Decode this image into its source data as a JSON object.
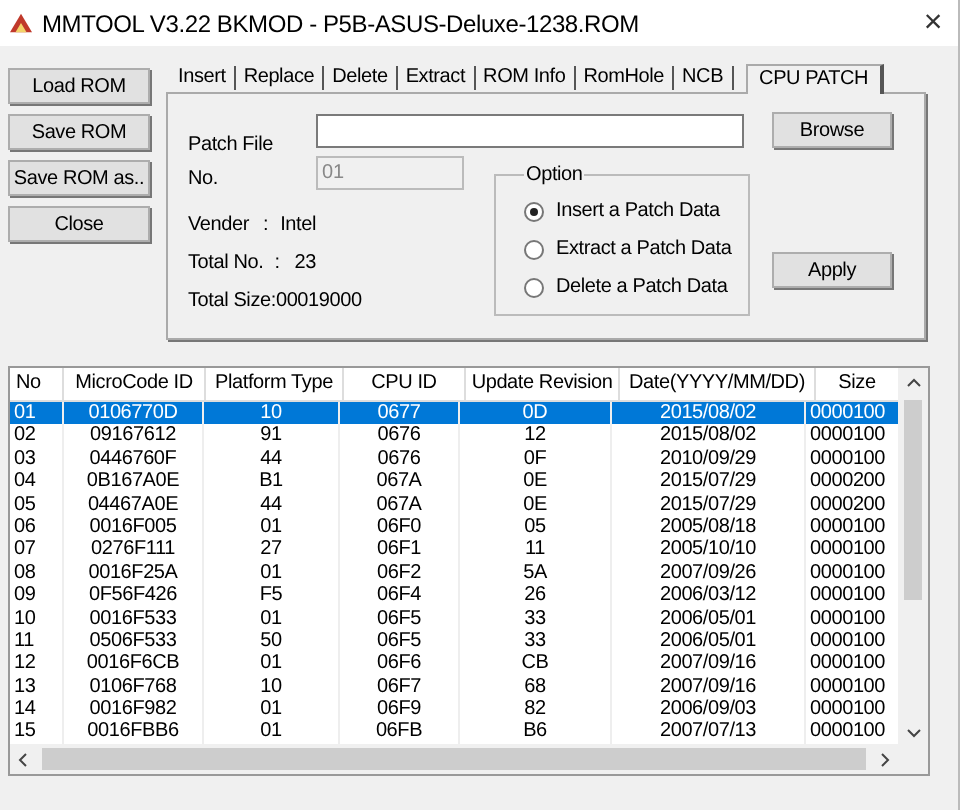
{
  "window": {
    "title": "MMTOOL V3.22 BKMOD - P5B-ASUS-Deluxe-1238.ROM",
    "close": "×"
  },
  "side_buttons": [
    "Load ROM",
    "Save ROM",
    "Save ROM as..",
    "Close"
  ],
  "tabs": [
    {
      "label": "Insert",
      "selected": false
    },
    {
      "label": "Replace",
      "selected": false
    },
    {
      "label": "Delete",
      "selected": false
    },
    {
      "label": "Extract",
      "selected": false
    },
    {
      "label": "ROM Info",
      "selected": false
    },
    {
      "label": "RomHole",
      "selected": false
    },
    {
      "label": "NCB",
      "selected": false
    },
    {
      "label": "CPU PATCH",
      "selected": true
    }
  ],
  "patch": {
    "file_label": "Patch File",
    "no_label": "No.",
    "no_value": "01",
    "browse": "Browse",
    "apply": "Apply",
    "info": [
      {
        "label": "Vender",
        "sep": ":",
        "value": "Intel"
      },
      {
        "label": "Total No.",
        "sep": ":",
        "value": "23"
      },
      {
        "label": "Total Size",
        "sep": ":",
        "value": "00019000"
      }
    ],
    "option": {
      "title": "Option",
      "choices": [
        {
          "label": "Insert a Patch Data",
          "selected": true
        },
        {
          "label": "Extract a Patch Data",
          "selected": false
        },
        {
          "label": "Delete a Patch Data",
          "selected": false
        }
      ]
    }
  },
  "table": {
    "columns": [
      "No",
      "MicroCode ID",
      "Platform Type",
      "CPU ID",
      "Update Revision",
      "Date(YYYY/MM/DD)",
      "Size"
    ],
    "rows": [
      {
        "cells": [
          "01",
          "0106770D",
          "10",
          "0677",
          "0D",
          "2015/08/02",
          "0000100"
        ],
        "selected": true
      },
      {
        "cells": [
          "02",
          "09167612",
          "91",
          "0676",
          "12",
          "2015/08/02",
          "0000100"
        ],
        "selected": false
      },
      {
        "cells": [
          "03",
          "0446760F",
          "44",
          "0676",
          "0F",
          "2010/09/29",
          "0000100"
        ],
        "selected": false
      },
      {
        "cells": [
          "04",
          "0B167A0E",
          "B1",
          "067A",
          "0E",
          "2015/07/29",
          "0000200"
        ],
        "selected": false
      },
      {
        "cells": [
          "05",
          "04467A0E",
          "44",
          "067A",
          "0E",
          "2015/07/29",
          "0000200"
        ],
        "selected": false
      },
      {
        "cells": [
          "06",
          "0016F005",
          "01",
          "06F0",
          "05",
          "2005/08/18",
          "0000100"
        ],
        "selected": false
      },
      {
        "cells": [
          "07",
          "0276F111",
          "27",
          "06F1",
          "11",
          "2005/10/10",
          "0000100"
        ],
        "selected": false
      },
      {
        "cells": [
          "08",
          "0016F25A",
          "01",
          "06F2",
          "5A",
          "2007/09/26",
          "0000100"
        ],
        "selected": false
      },
      {
        "cells": [
          "09",
          "0F56F426",
          "F5",
          "06F4",
          "26",
          "2006/03/12",
          "0000100"
        ],
        "selected": false
      },
      {
        "cells": [
          "10",
          "0016F533",
          "01",
          "06F5",
          "33",
          "2006/05/01",
          "0000100"
        ],
        "selected": false
      },
      {
        "cells": [
          "11",
          "0506F533",
          "50",
          "06F5",
          "33",
          "2006/05/01",
          "0000100"
        ],
        "selected": false
      },
      {
        "cells": [
          "12",
          "0016F6CB",
          "01",
          "06F6",
          "CB",
          "2007/09/16",
          "0000100"
        ],
        "selected": false
      },
      {
        "cells": [
          "13",
          "0106F768",
          "10",
          "06F7",
          "68",
          "2007/09/16",
          "0000100"
        ],
        "selected": false
      },
      {
        "cells": [
          "14",
          "0016F982",
          "01",
          "06F9",
          "82",
          "2006/09/03",
          "0000100"
        ],
        "selected": false
      },
      {
        "cells": [
          "15",
          "0016FBB6",
          "01",
          "06FB",
          "B6",
          "2007/07/13",
          "0000100"
        ],
        "selected": false
      }
    ]
  }
}
